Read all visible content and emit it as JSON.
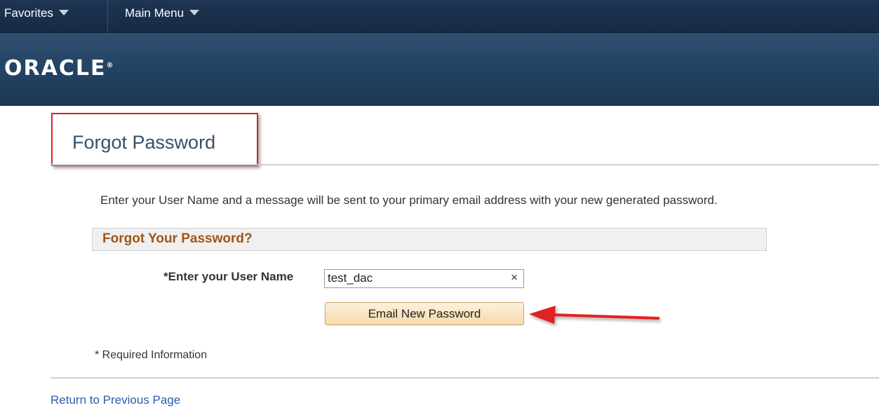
{
  "navbar": {
    "favorites_label": "Favorites",
    "main_menu_label": "Main Menu"
  },
  "banner": {
    "logo_text": "ORACLE"
  },
  "page": {
    "title": "Forgot Password",
    "instructions": "Enter your User Name and a message will be sent to your primary email address with your new generated password."
  },
  "form": {
    "group_title": "Forgot Your Password?",
    "username_label": "*Enter your User Name",
    "username_value": "test_dac",
    "clear_icon": "×",
    "submit_label": "Email New Password"
  },
  "footer": {
    "required_note": "* Required Information",
    "return_link": "Return to Previous Page"
  },
  "colors": {
    "navbar": "#1e3553",
    "banner": "#2f4f73",
    "title_text": "#37506b",
    "group_title": "#a05516",
    "highlight_red": "#e02020",
    "link": "#2a5cae",
    "button_bg": "#f6d9a9"
  },
  "icons": {
    "favorites_caret": "chevron-down-icon",
    "main_menu_caret": "chevron-down-icon",
    "clear": "close-icon",
    "annotation": "arrow-left-icon"
  }
}
